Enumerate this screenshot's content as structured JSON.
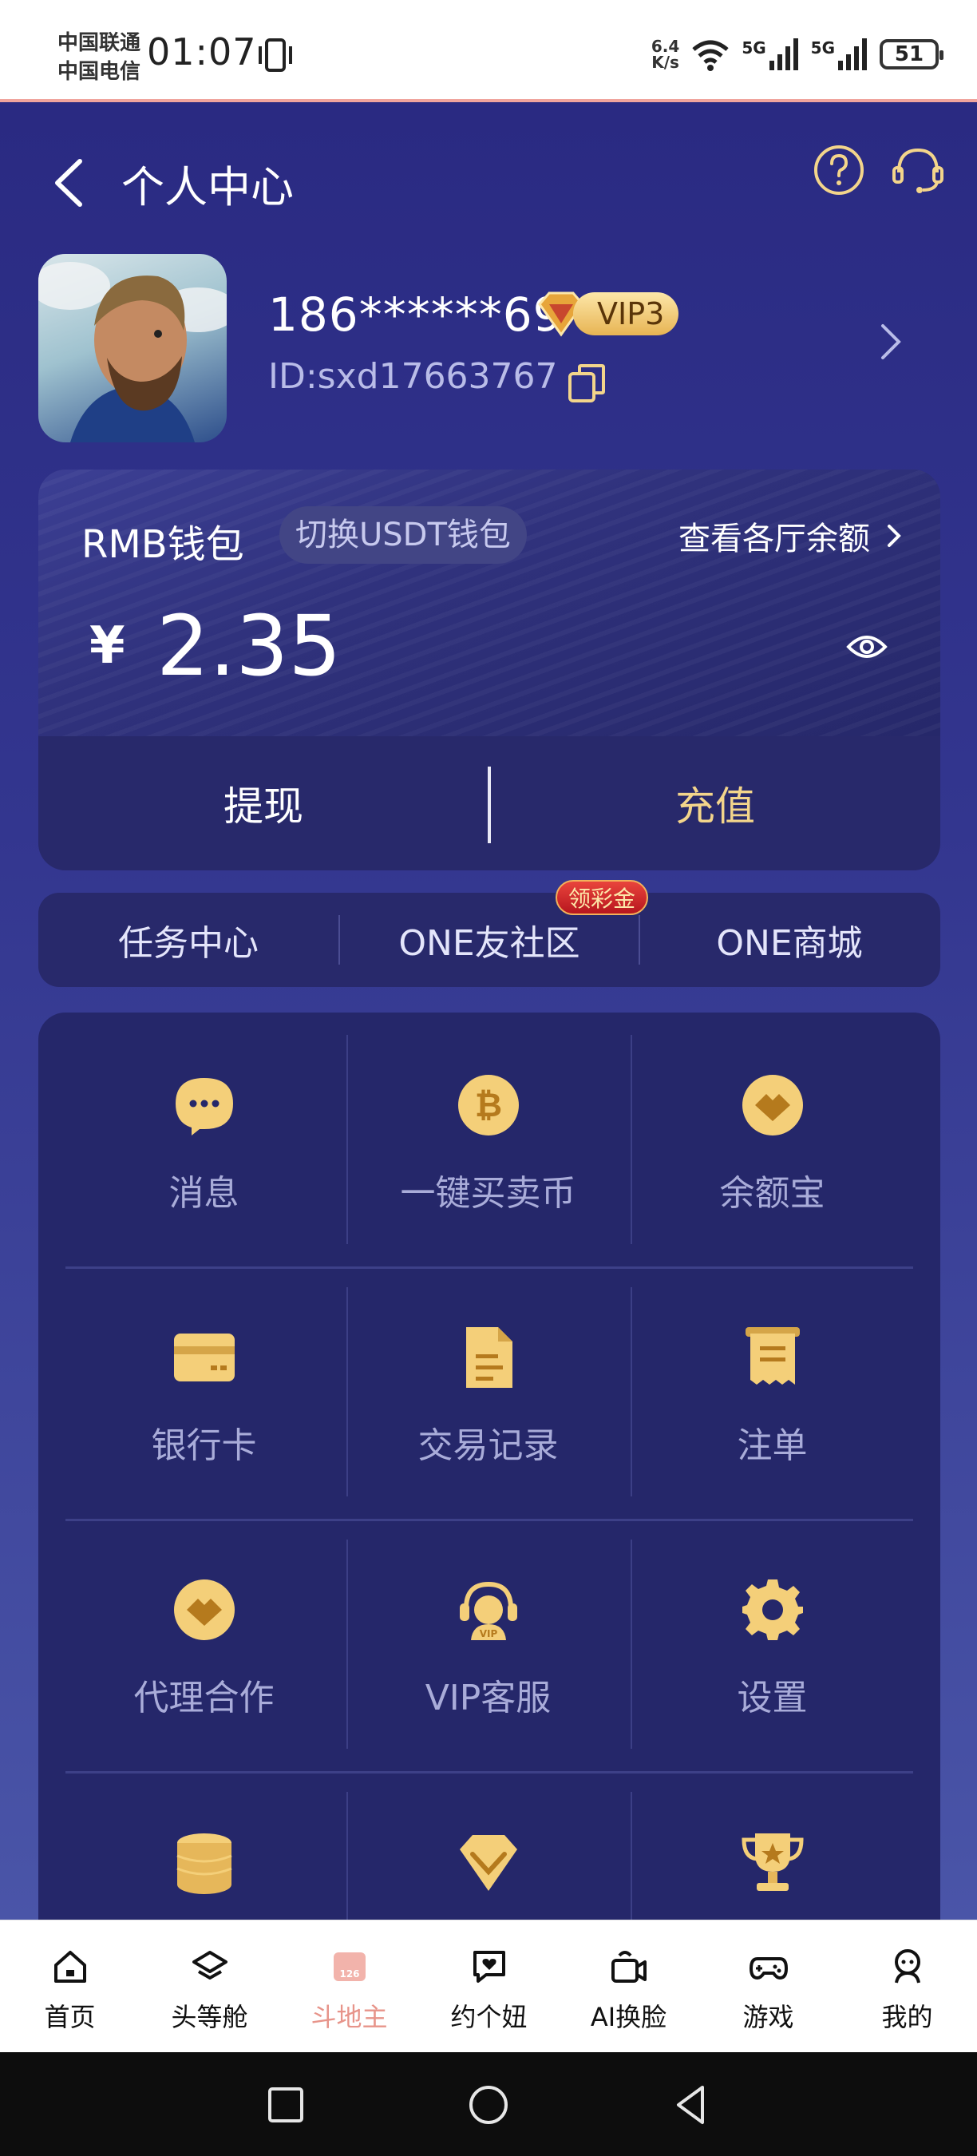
{
  "status_bar": {
    "carrier_1": "中国联通",
    "carrier_2": "中国电信",
    "time": "01:07",
    "speed_value": "6.4",
    "speed_unit": "K/s",
    "network_1": "5G",
    "network_2": "5G",
    "battery": "51"
  },
  "header": {
    "title": "个人中心"
  },
  "profile": {
    "phone": "186******69",
    "vip_level": "VIP3",
    "user_id": "ID:sxd17663767"
  },
  "wallet": {
    "name": "RMB钱包",
    "switch_label": "切换USDT钱包",
    "view_balances_label": "查看各厅余额",
    "currency_symbol": "¥",
    "balance": "2.35",
    "withdraw_label": "提现",
    "deposit_label": "充值"
  },
  "quick_links": {
    "task_center": "任务中心",
    "community": "ONE友社区",
    "community_badge": "领彩金",
    "mall": "ONE商城"
  },
  "menu": {
    "items": [
      {
        "label": "消息",
        "icon": "message-icon"
      },
      {
        "label": "一键买卖币",
        "icon": "bitcoin-icon"
      },
      {
        "label": "余额宝",
        "icon": "balance-treasure-icon"
      },
      {
        "label": "银行卡",
        "icon": "bank-card-icon"
      },
      {
        "label": "交易记录",
        "icon": "document-icon"
      },
      {
        "label": "注单",
        "icon": "receipt-icon"
      },
      {
        "label": "代理合作",
        "icon": "handshake-icon"
      },
      {
        "label": "VIP客服",
        "icon": "vip-headset-icon"
      },
      {
        "label": "设置",
        "icon": "gear-icon"
      },
      {
        "label": "",
        "icon": "coin-stack-icon"
      },
      {
        "label": "",
        "icon": "diamond-icon"
      },
      {
        "label": "",
        "icon": "trophy-icon"
      }
    ]
  },
  "tab_bar": {
    "items": [
      {
        "label": "首页",
        "icon": "home-icon"
      },
      {
        "label": "头等舱",
        "icon": "first-class-icon"
      },
      {
        "label": "斗地主",
        "icon": "poker-game-icon",
        "active": true
      },
      {
        "label": "约个妞",
        "icon": "heart-chat-icon"
      },
      {
        "label": "AI换脸",
        "icon": "camera-icon"
      },
      {
        "label": "游戏",
        "icon": "gamepad-icon"
      },
      {
        "label": "我的",
        "icon": "user-icon"
      }
    ],
    "poker_badge_text": "126"
  },
  "colors": {
    "background": "#2a2a82",
    "card": "#25276a",
    "gold": "#f3d58b",
    "active_tab": "#e7948a"
  }
}
